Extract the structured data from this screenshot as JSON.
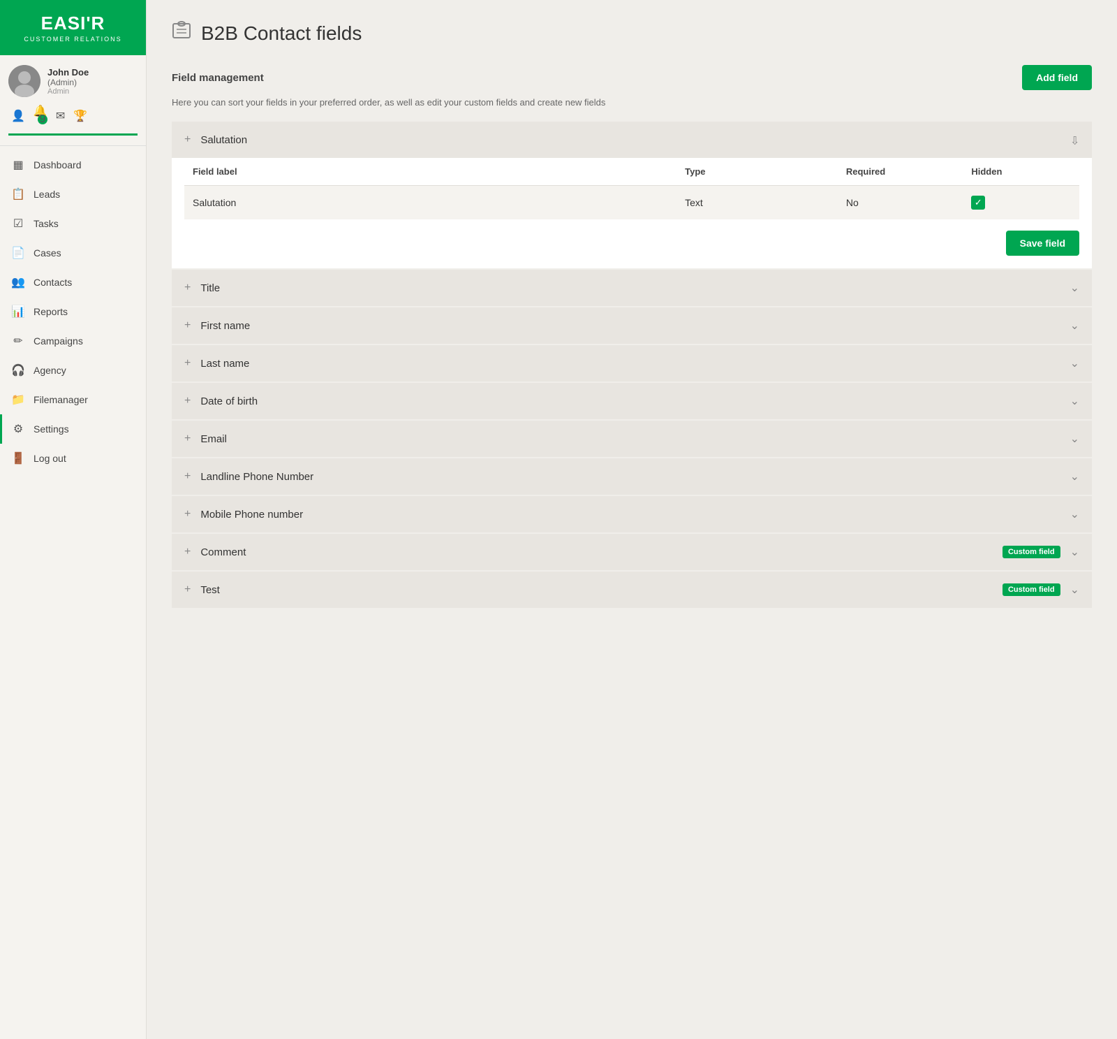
{
  "logo": {
    "text": "EASI'R",
    "sub": "CUSTOMER RELATIONS"
  },
  "user": {
    "name": "John Doe",
    "role": "(Admin)",
    "label": "Admin",
    "badge": "9"
  },
  "nav": {
    "items": [
      {
        "id": "dashboard",
        "label": "Dashboard",
        "icon": "▦"
      },
      {
        "id": "leads",
        "label": "Leads",
        "icon": "📋"
      },
      {
        "id": "tasks",
        "label": "Tasks",
        "icon": "☑"
      },
      {
        "id": "cases",
        "label": "Cases",
        "icon": "📄"
      },
      {
        "id": "contacts",
        "label": "Contacts",
        "icon": "👥"
      },
      {
        "id": "reports",
        "label": "Reports",
        "icon": "📊"
      },
      {
        "id": "campaigns",
        "label": "Campaigns",
        "icon": "✏"
      },
      {
        "id": "agency",
        "label": "Agency",
        "icon": "🎧"
      },
      {
        "id": "filemanager",
        "label": "Filemanager",
        "icon": "📁"
      },
      {
        "id": "settings",
        "label": "Settings",
        "icon": "⚙"
      },
      {
        "id": "logout",
        "label": "Log out",
        "icon": "🚪"
      }
    ]
  },
  "page": {
    "title": "B2B Contact fields",
    "section": "Field management",
    "description": "Here you can sort your fields in your preferred order, as well as edit your custom fields and create new fields",
    "add_field_label": "Add field",
    "save_field_label": "Save field"
  },
  "fields": {
    "table_headers": {
      "label": "Field label",
      "type": "Type",
      "required": "Required",
      "hidden": "Hidden"
    },
    "expanded": {
      "name": "Salutation",
      "row": {
        "label": "Salutation",
        "type": "Text",
        "required": "No",
        "hidden_checked": true
      }
    },
    "collapsed": [
      {
        "id": "title",
        "label": "Title",
        "custom": false
      },
      {
        "id": "firstname",
        "label": "First name",
        "custom": false
      },
      {
        "id": "lastname",
        "label": "Last name",
        "custom": false
      },
      {
        "id": "dob",
        "label": "Date of birth",
        "custom": false
      },
      {
        "id": "email",
        "label": "Email",
        "custom": false
      },
      {
        "id": "landline",
        "label": "Landline Phone Number",
        "custom": false
      },
      {
        "id": "mobile",
        "label": "Mobile Phone number",
        "custom": false
      },
      {
        "id": "comment",
        "label": "Comment",
        "custom": true
      },
      {
        "id": "test",
        "label": "Test",
        "custom": true
      }
    ],
    "custom_badge_label": "Custom field"
  }
}
